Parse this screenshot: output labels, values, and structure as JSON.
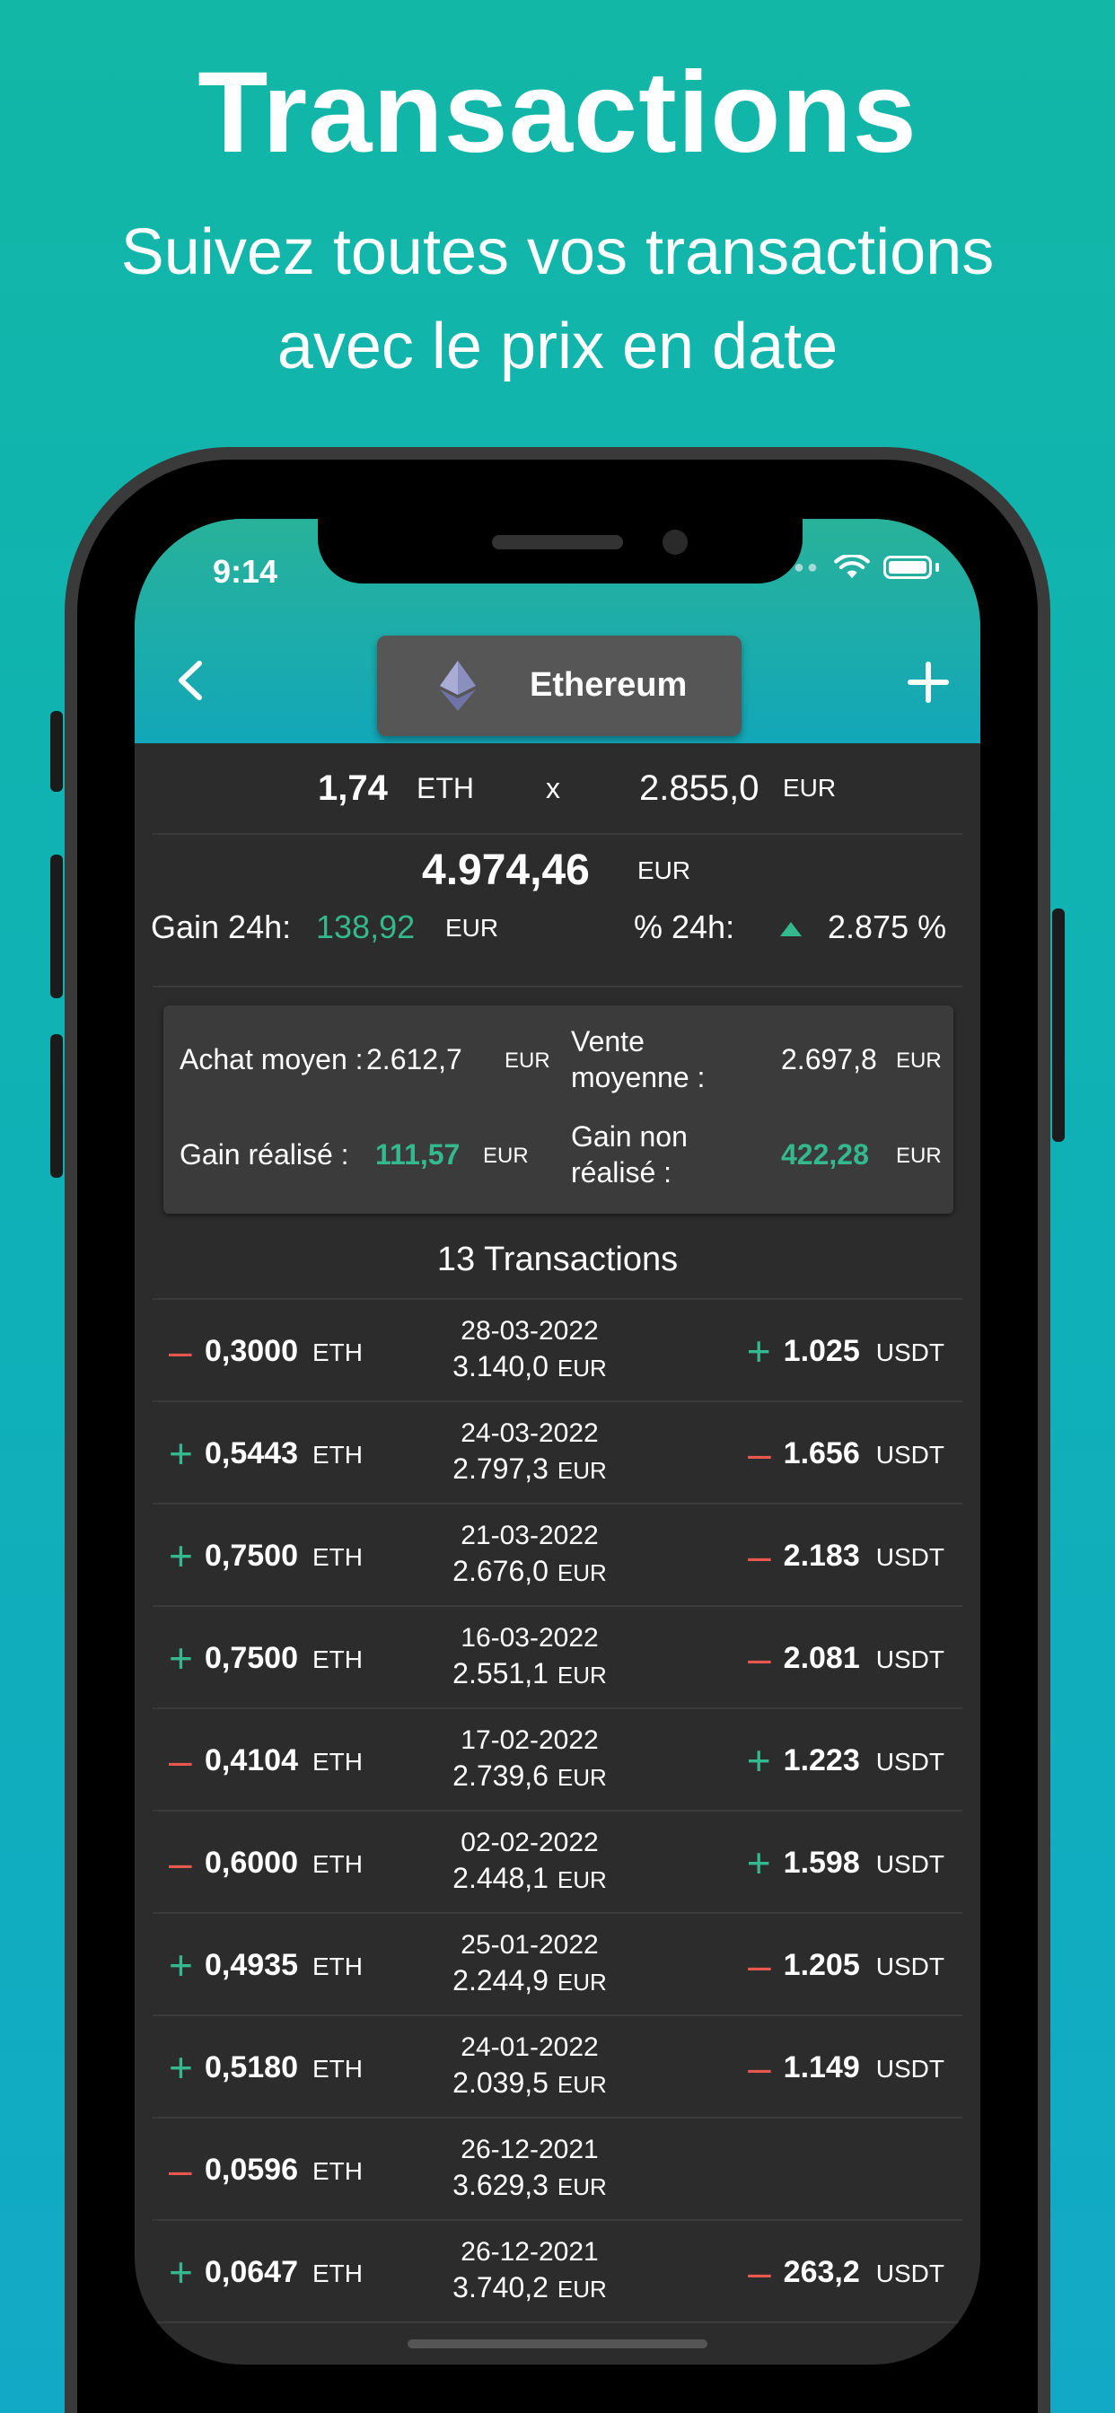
{
  "promo": {
    "title": "Transactions",
    "subtitle_line1": "Suivez toutes vos transactions",
    "subtitle_line2": "avec le prix en date"
  },
  "status_bar": {
    "time": "9:14"
  },
  "header": {
    "coin_name": "Ethereum"
  },
  "position": {
    "quantity": "1,74",
    "quantity_unit": "ETH",
    "times": "x",
    "price": "2.855,0",
    "price_unit": "EUR",
    "total": "4.974,46",
    "total_unit": "EUR",
    "gain24_label": "Gain 24h:",
    "gain24_value": "138,92",
    "gain24_unit": "EUR",
    "pct24_label": "% 24h:",
    "pct24_value": "2.875 %"
  },
  "summary": {
    "avg_buy_label": "Achat moyen :",
    "avg_buy_value": "2.612,7",
    "avg_buy_unit": "EUR",
    "avg_sell_label_1": "Vente",
    "avg_sell_label_2": "moyenne :",
    "avg_sell_value": "2.697,8",
    "avg_sell_unit": "EUR",
    "realized_label": "Gain réalisé :",
    "realized_value": "111,57",
    "realized_unit": "EUR",
    "unrealized_label_1": "Gain non",
    "unrealized_label_2": "réalisé :",
    "unrealized_value": "422,28",
    "unrealized_unit": "EUR"
  },
  "transactions_count_label": "13 Transactions",
  "transactions": [
    {
      "sign": "–",
      "amount": "0,3000",
      "unit": "ETH",
      "date": "28-03-2022",
      "price": "3.140,0",
      "price_unit": "EUR",
      "other_sign": "+",
      "other_amount": "1.025",
      "other_unit": "USDT"
    },
    {
      "sign": "+",
      "amount": "0,5443",
      "unit": "ETH",
      "date": "24-03-2022",
      "price": "2.797,3",
      "price_unit": "EUR",
      "other_sign": "–",
      "other_amount": "1.656",
      "other_unit": "USDT"
    },
    {
      "sign": "+",
      "amount": "0,7500",
      "unit": "ETH",
      "date": "21-03-2022",
      "price": "2.676,0",
      "price_unit": "EUR",
      "other_sign": "–",
      "other_amount": "2.183",
      "other_unit": "USDT"
    },
    {
      "sign": "+",
      "amount": "0,7500",
      "unit": "ETH",
      "date": "16-03-2022",
      "price": "2.551,1",
      "price_unit": "EUR",
      "other_sign": "–",
      "other_amount": "2.081",
      "other_unit": "USDT"
    },
    {
      "sign": "–",
      "amount": "0,4104",
      "unit": "ETH",
      "date": "17-02-2022",
      "price": "2.739,6",
      "price_unit": "EUR",
      "other_sign": "+",
      "other_amount": "1.223",
      "other_unit": "USDT"
    },
    {
      "sign": "–",
      "amount": "0,6000",
      "unit": "ETH",
      "date": "02-02-2022",
      "price": "2.448,1",
      "price_unit": "EUR",
      "other_sign": "+",
      "other_amount": "1.598",
      "other_unit": "USDT"
    },
    {
      "sign": "+",
      "amount": "0,4935",
      "unit": "ETH",
      "date": "25-01-2022",
      "price": "2.244,9",
      "price_unit": "EUR",
      "other_sign": "–",
      "other_amount": "1.205",
      "other_unit": "USDT"
    },
    {
      "sign": "+",
      "amount": "0,5180",
      "unit": "ETH",
      "date": "24-01-2022",
      "price": "2.039,5",
      "price_unit": "EUR",
      "other_sign": "–",
      "other_amount": "1.149",
      "other_unit": "USDT"
    },
    {
      "sign": "–",
      "amount": "0,0596",
      "unit": "ETH",
      "date": "26-12-2021",
      "price": "3.629,3",
      "price_unit": "EUR",
      "other_sign": "",
      "other_amount": "",
      "other_unit": ""
    },
    {
      "sign": "+",
      "amount": "0,0647",
      "unit": "ETH",
      "date": "26-12-2021",
      "price": "3.740,2",
      "price_unit": "EUR",
      "other_sign": "–",
      "other_amount": "263,2",
      "other_unit": "USDT"
    }
  ],
  "colors": {
    "positive": "#33b98d",
    "negative": "#e8584f"
  }
}
